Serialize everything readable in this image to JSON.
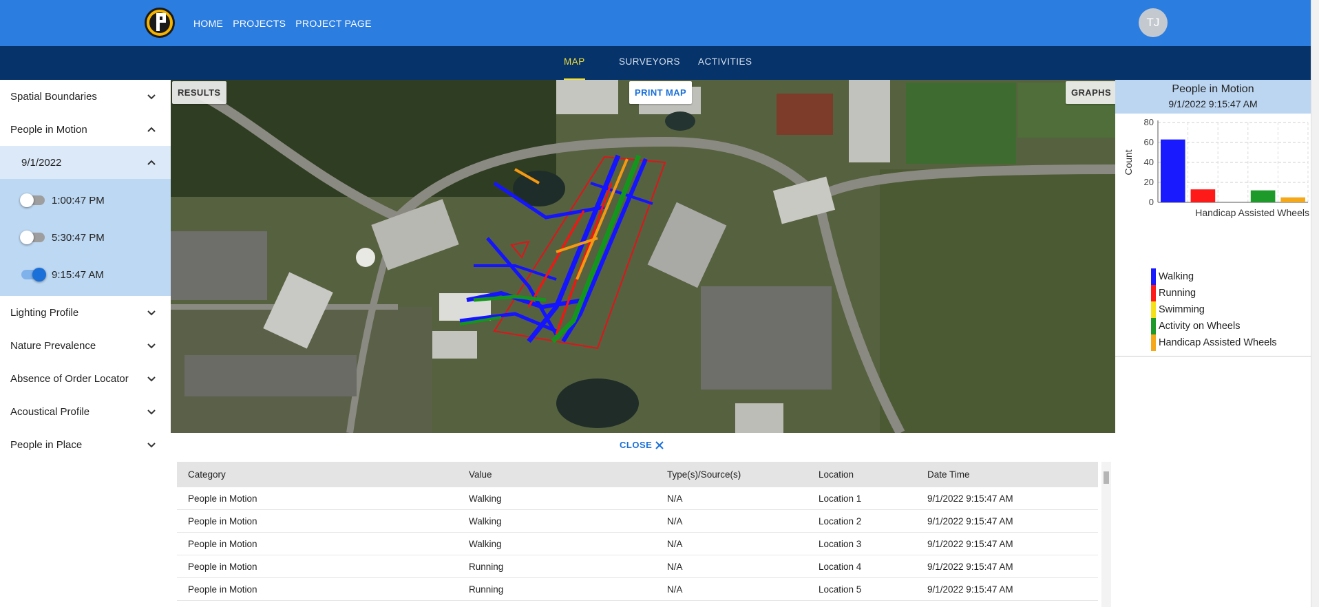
{
  "header": {
    "nav": [
      "HOME",
      "PROJECTS",
      "PROJECT PAGE"
    ],
    "avatar_initials": "TJ",
    "brand_color": "#2b7de0"
  },
  "subnav": {
    "tabs": [
      "MAP",
      "SURVEYORS",
      "ACTIVITIES"
    ],
    "active_tab": "MAP"
  },
  "sidebar": {
    "items": [
      {
        "label": "Spatial Boundaries",
        "expanded": false
      },
      {
        "label": "People in Motion",
        "expanded": true
      },
      {
        "label": "Lighting Profile",
        "expanded": false
      },
      {
        "label": "Nature Prevalence",
        "expanded": false
      },
      {
        "label": "Absence of Order Locator",
        "expanded": false
      },
      {
        "label": "Acoustical Profile",
        "expanded": false
      },
      {
        "label": "People in Place",
        "expanded": false
      }
    ],
    "date": "9/1/2022",
    "times": [
      {
        "label": "1:00:47 PM",
        "on": false
      },
      {
        "label": "5:30:47 PM",
        "on": false
      },
      {
        "label": "9:15:47 AM",
        "on": true
      }
    ]
  },
  "map": {
    "results_label": "RESULTS",
    "print_label": "PRINT MAP",
    "graphs_label": "GRAPHS"
  },
  "graph": {
    "title": "People in Motion",
    "subtitle": "9/1/2022 9:15:47 AM",
    "legend": [
      {
        "name": "Walking",
        "color": "#1a1aff"
      },
      {
        "name": "Running",
        "color": "#ff1a1a"
      },
      {
        "name": "Swimming",
        "color": "#f5e11a"
      },
      {
        "name": "Activity on Wheels",
        "color": "#1e9a2a"
      },
      {
        "name": "Handicap Assisted Wheels",
        "color": "#f5a91a"
      }
    ]
  },
  "chart_data": {
    "type": "bar",
    "title": "People in Motion",
    "subtitle": "9/1/2022 9:15:47 AM",
    "categories": [
      "Walking",
      "Running",
      "Swimming",
      "Activity on Wheels",
      "Handicap Assisted Wheels"
    ],
    "visible_xlabel": "Handicap Assisted Wheels",
    "values": [
      63,
      13,
      0,
      12,
      5
    ],
    "colors": [
      "#1a1aff",
      "#ff1a1a",
      "#f5e11a",
      "#1e9a2a",
      "#f5a91a"
    ],
    "ylabel": "Count",
    "ylim": [
      0,
      80
    ],
    "yticks": [
      0,
      20,
      40,
      60,
      80
    ],
    "grid": true,
    "legend": "bottom"
  },
  "drawer": {
    "close_label": "CLOSE",
    "columns": [
      "Category",
      "Value",
      "Type(s)/Source(s)",
      "Location",
      "Date Time"
    ],
    "rows": [
      [
        "People in Motion",
        "Walking",
        "N/A",
        "Location 1",
        "9/1/2022 9:15:47 AM"
      ],
      [
        "People in Motion",
        "Walking",
        "N/A",
        "Location 2",
        "9/1/2022 9:15:47 AM"
      ],
      [
        "People in Motion",
        "Walking",
        "N/A",
        "Location 3",
        "9/1/2022 9:15:47 AM"
      ],
      [
        "People in Motion",
        "Running",
        "N/A",
        "Location 4",
        "9/1/2022 9:15:47 AM"
      ],
      [
        "People in Motion",
        "Running",
        "N/A",
        "Location 5",
        "9/1/2022 9:15:47 AM"
      ]
    ]
  }
}
